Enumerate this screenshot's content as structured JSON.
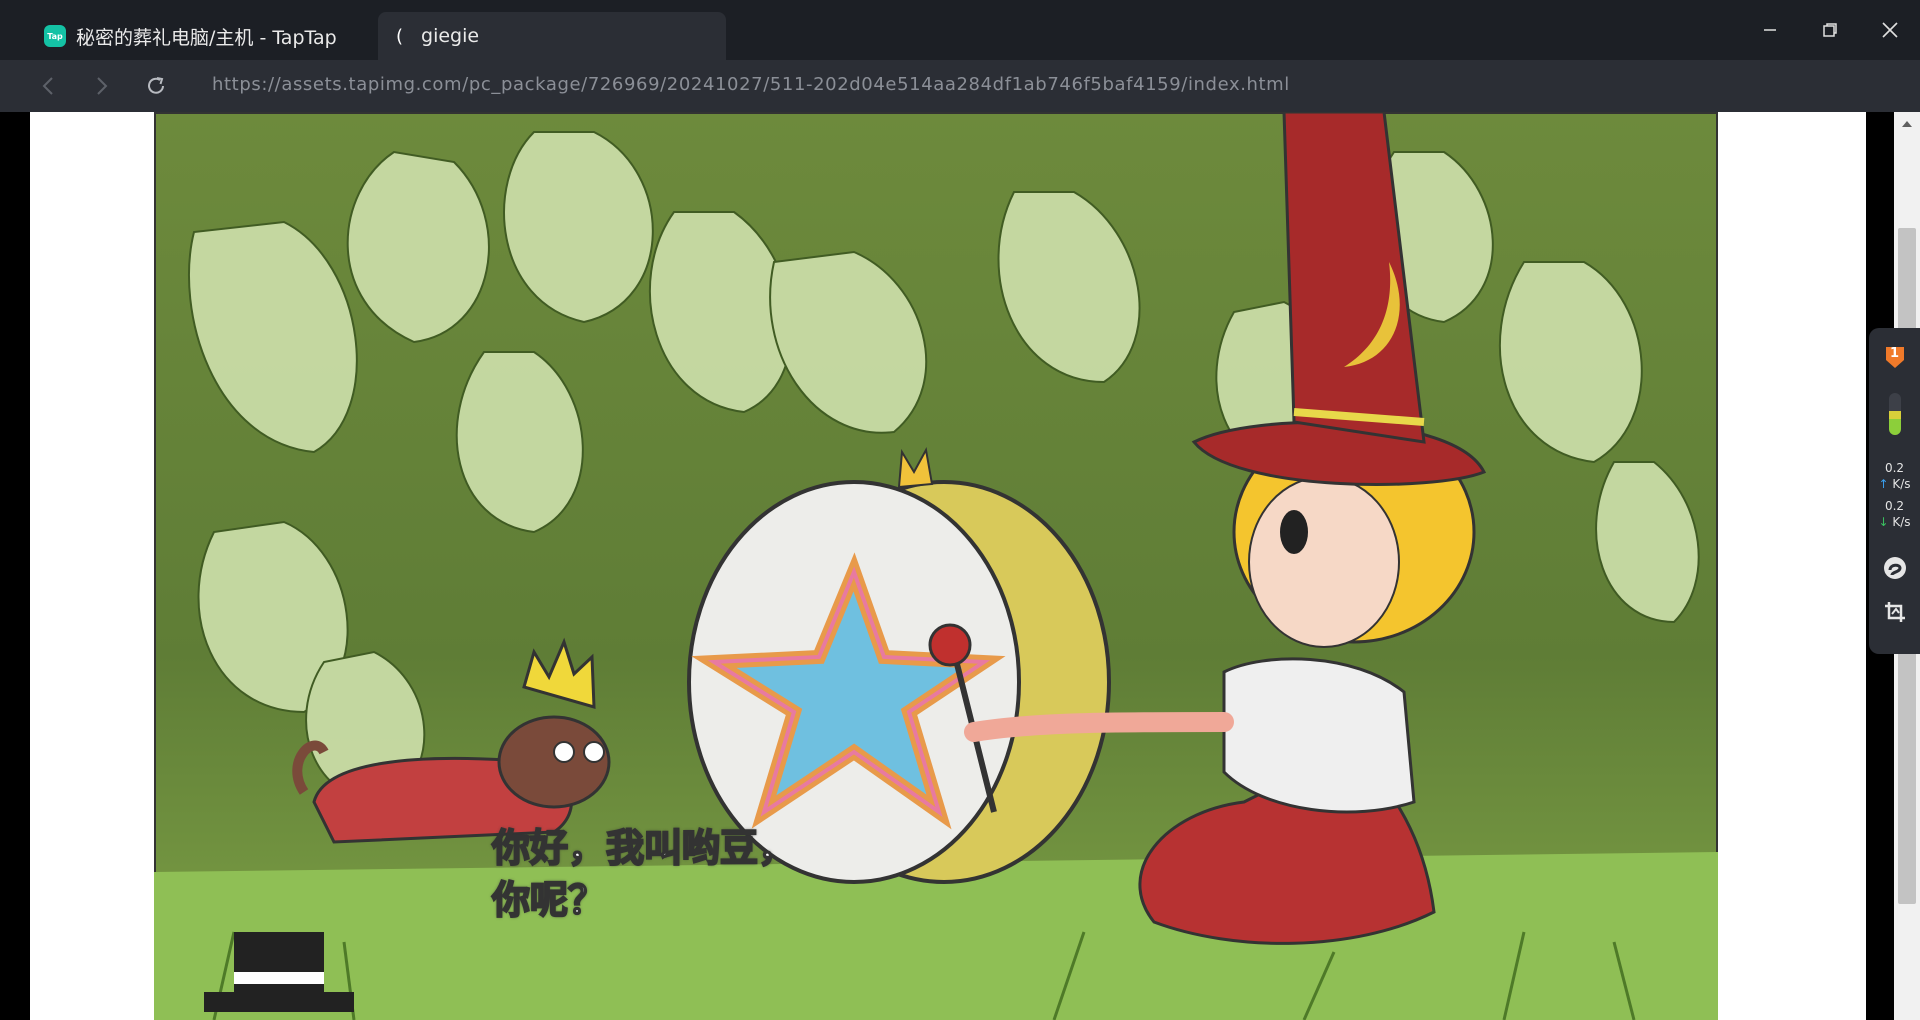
{
  "window": {
    "tabs": [
      {
        "label": "秘密的葬礼电脑/主机 - TapTap",
        "icon": "taptap-logo-icon",
        "icon_text": "Tap"
      },
      {
        "label": "giegie",
        "icon": "crescent-moon-icon"
      }
    ],
    "controls": [
      "minimize-icon",
      "restore-icon",
      "close-icon"
    ]
  },
  "address_bar": {
    "url": "https://assets.tapimg.com/pc_package/726969/20241027/511-202d04e514aa284df1ab746f5baf4159/index.html"
  },
  "page": {
    "speech_line1": "你好，我叫哟豆，",
    "speech_line2": "你呢？"
  },
  "side_panel": {
    "badge_number": "1",
    "upload_value": "0.2",
    "upload_unit": "K/s",
    "download_value": "0.2",
    "download_unit": "K/s"
  },
  "colors": {
    "titlebar": "#1c1f25",
    "active_tab": "#2b2e35",
    "taptap_brand": "#14c2a5",
    "hat_red": "#a72a2a",
    "foliage": "#7a9a4a"
  }
}
